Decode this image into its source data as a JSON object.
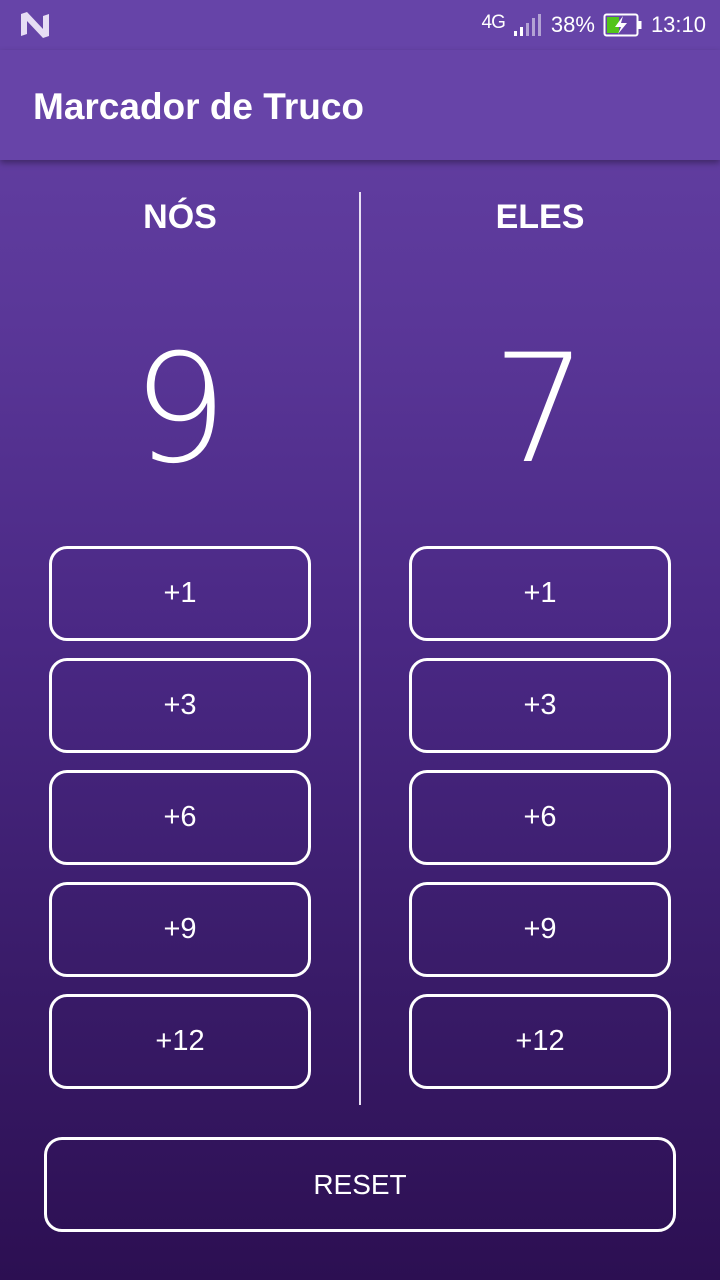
{
  "status": {
    "network": "4G",
    "battery": "38%",
    "time": "13:10"
  },
  "app": {
    "title": "Marcador de Truco"
  },
  "teams": [
    {
      "name": "NÓS",
      "score": "9",
      "buttons": [
        "+1",
        "+3",
        "+6",
        "+9",
        "+12"
      ]
    },
    {
      "name": "ELES",
      "score": "7",
      "buttons": [
        "+1",
        "+3",
        "+6",
        "+9",
        "+12"
      ]
    }
  ],
  "reset_label": "RESET",
  "colors": {
    "primary": "#6744a8",
    "gradient_top": "#6642a6",
    "gradient_bottom": "#2c0f52",
    "battery_charging": "#52c41a"
  }
}
